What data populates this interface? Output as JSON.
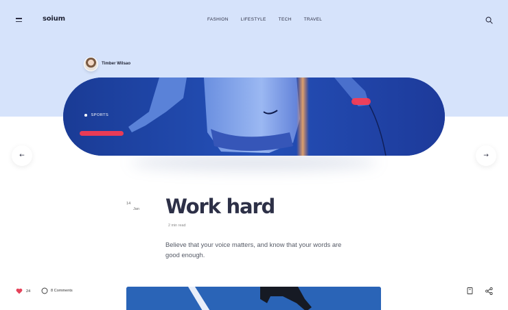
{
  "header": {
    "logo": "soium",
    "nav": [
      "FASHION",
      "LIFESTYLE",
      "TECH",
      "TRAVEL"
    ],
    "menu_icon": "hamburger-menu-icon",
    "search_icon": "search-icon"
  },
  "author": {
    "name": "Timber Wilsao"
  },
  "hero": {
    "category": "SPORTS"
  },
  "article": {
    "date_day": "14",
    "date_month": "Jan",
    "title": "Work hard",
    "read_time": "2 min read",
    "excerpt": "Believe that your voice matters, and know that your words are good enough."
  },
  "footer_bar": {
    "likes": "24",
    "comments": "8 Comments"
  },
  "colors": {
    "top_band": "#d6e3fb",
    "heart": "#e5435a",
    "hero_blue": "#1b3d9a"
  }
}
